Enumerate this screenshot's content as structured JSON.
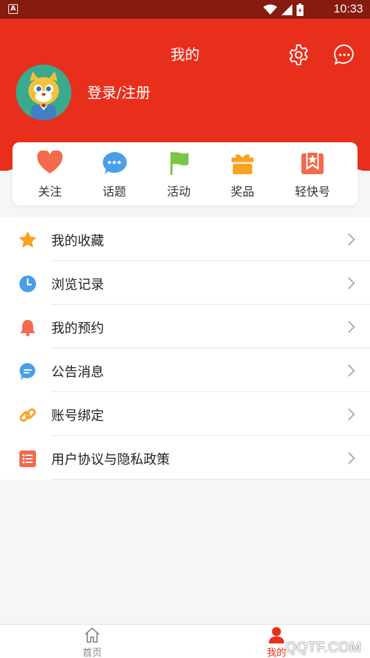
{
  "status_bar": {
    "app_badge": "A",
    "time": "10:33"
  },
  "header": {
    "title": "我的",
    "login_text": "登录/注册"
  },
  "quick_actions": [
    {
      "label": "关注",
      "icon": "heart-icon",
      "color": "#f46a4c"
    },
    {
      "label": "话题",
      "icon": "chat-bubble-icon",
      "color": "#4a9ee8"
    },
    {
      "label": "活动",
      "icon": "flag-icon",
      "color": "#7cc444"
    },
    {
      "label": "奖品",
      "icon": "gift-icon",
      "color": "#f7a320"
    },
    {
      "label": "轻快号",
      "icon": "bookmark-star-icon",
      "color": "#f46a4c"
    }
  ],
  "menu": [
    {
      "label": "我的收藏",
      "icon": "star-icon",
      "color": "#f7a320"
    },
    {
      "label": " 浏览记录",
      "icon": "clock-icon",
      "color": "#4a9ee8"
    },
    {
      "label": "我的预约",
      "icon": "bell-icon",
      "color": "#f46a4c"
    },
    {
      "label": "公告消息",
      "icon": "message-icon",
      "color": "#4a9ee8"
    },
    {
      "label": "账号绑定",
      "icon": "link-icon",
      "color": "#f7a320"
    },
    {
      "label": "用户协议与隐私政策",
      "icon": "list-icon",
      "color": "#f46a4c"
    }
  ],
  "tabbar": {
    "home": "首页",
    "mine": "我的",
    "active_color": "#e82f1c"
  },
  "watermark": "QQTF.COM",
  "colors": {
    "brand_red": "#e82f1c",
    "status_bar": "#861b0f"
  }
}
